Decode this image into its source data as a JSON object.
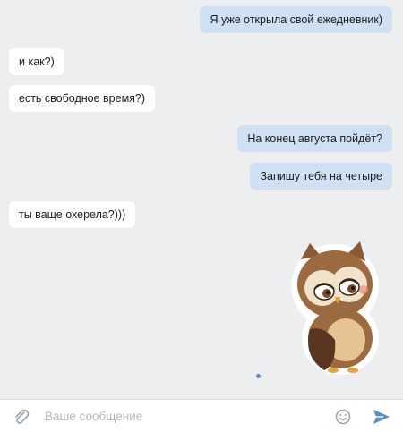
{
  "messages": [
    {
      "direction": "outgoing",
      "text": "Я уже открыла свой ежедневник)"
    },
    {
      "direction": "incoming",
      "text": "и как?)"
    },
    {
      "direction": "incoming",
      "text": "есть свободное время?)"
    },
    {
      "direction": "outgoing",
      "text": "На конец августа пойдёт?"
    },
    {
      "direction": "outgoing",
      "text": "Запишу тебя  на четыре"
    },
    {
      "direction": "incoming",
      "text": "ты ваще охерела?)))"
    }
  ],
  "sticker": {
    "icon": "owl-sticker"
  },
  "composer": {
    "placeholder": "Ваше сообщение",
    "attach_icon": "paperclip-icon",
    "emoji_icon": "smiley-icon",
    "send_icon": "send-arrow-icon"
  },
  "colors": {
    "background": "#edeef0",
    "outgoing_bubble": "#cfe0f4",
    "incoming_bubble": "#ffffff",
    "accent": "#5d8ec4"
  }
}
